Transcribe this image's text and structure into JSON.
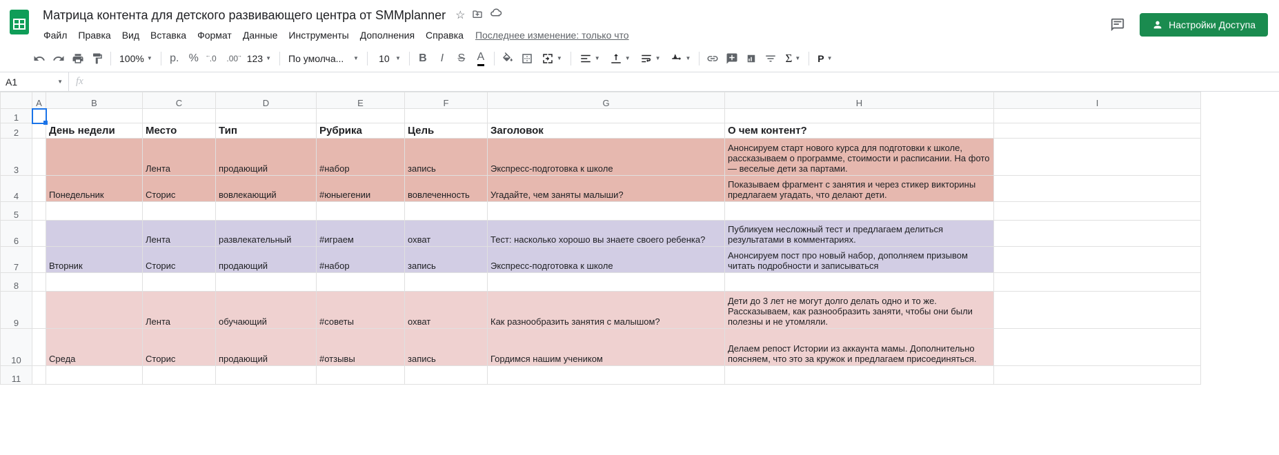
{
  "header": {
    "title": "Матрица контента для детского развивающего центра от SMMplanner",
    "share_label": "Настройки Доступа",
    "last_edit": "Последнее изменение: только что"
  },
  "menubar": [
    "Файл",
    "Правка",
    "Вид",
    "Вставка",
    "Формат",
    "Данные",
    "Инструменты",
    "Дополнения",
    "Справка"
  ],
  "toolbar": {
    "zoom": "100%",
    "currency": "р.",
    "percent": "%",
    "dec_minus": ".0",
    "dec_plus": ".00",
    "more_formats": "123",
    "font": "По умолча...",
    "font_size": "10"
  },
  "name_box": "A1",
  "fx_placeholder": "fx",
  "columns": [
    "A",
    "B",
    "C",
    "D",
    "E",
    "F",
    "G",
    "H",
    "I"
  ],
  "col_widths": [
    "col-A",
    "col-B",
    "col-C",
    "col-D",
    "col-E",
    "col-F",
    "col-G",
    "col-H",
    "col-I"
  ],
  "row_heights": [
    "row-1",
    "row-header-row",
    "row-data-triple",
    "row-data-double",
    "row-data-single",
    "row-data-double",
    "row-data-double",
    "row-data-single",
    "row-data-triple",
    "row-data-triple",
    "row-data-single"
  ],
  "row_colors": [
    "",
    "",
    "bg-pink",
    "bg-pink",
    "",
    "bg-purple",
    "bg-purple",
    "",
    "bg-lightpink",
    "bg-lightpink",
    ""
  ],
  "rows": [
    [
      "",
      "",
      "",
      "",
      "",
      "",
      "",
      "",
      ""
    ],
    [
      "",
      "День недели",
      "Место",
      "Тип",
      "Рубрика",
      "Цель",
      "Заголовок",
      "О чем контент?",
      ""
    ],
    [
      "",
      "",
      "Лента",
      "продающий",
      "#набор",
      "запись",
      "Экспресс-подготовка к школе",
      "Анонсируем старт нового курса для подготовки к школе, рассказываем о программе, стоимости и расписании. На фото — веселые дети за партами.",
      ""
    ],
    [
      "",
      "Понедельник",
      "Сторис",
      "вовлекающий",
      "#юныегении",
      "вовлеченность",
      "Угадайте, чем заняты малыши?",
      "Показываем фрагмент с занятия и через стикер викторины предлагаем угадать, что делают дети.",
      ""
    ],
    [
      "",
      "",
      "",
      "",
      "",
      "",
      "",
      "",
      ""
    ],
    [
      "",
      "",
      "Лента",
      "развлекательный",
      "#играем",
      "охват",
      "Тест: насколько хорошо вы знаете своего ребенка?",
      "Публикуем несложный тест и предлагаем делиться результатами в комментариях.",
      ""
    ],
    [
      "",
      "Вторник",
      "Сторис",
      "продающий",
      "#набор",
      "запись",
      "Экспресс-подготовка к школе",
      "Анонсируем пост про новый набор, дополняем призывом читать подробности и записываться",
      ""
    ],
    [
      "",
      "",
      "",
      "",
      "",
      "",
      "",
      "",
      ""
    ],
    [
      "",
      "",
      "Лента",
      "обучающий",
      "#советы",
      "охват",
      "Как разнообразить занятия с малышом?",
      "Дети до 3 лет не могут долго делать одно и то же. Рассказываем, как разнообразить заняти, чтобы они были полезны и не утомляли.",
      ""
    ],
    [
      "",
      "Среда",
      "Сторис",
      "продающий",
      "#отзывы",
      "запись",
      "Гордимся нашим учеником",
      "Делаем репост Истории из аккаунта мамы. Дополнительно поясняем, что это за кружок и предлагаем присоединяться.",
      ""
    ],
    [
      "",
      "",
      "",
      "",
      "",
      "",
      "",
      "",
      ""
    ]
  ],
  "header_row_index": 1
}
